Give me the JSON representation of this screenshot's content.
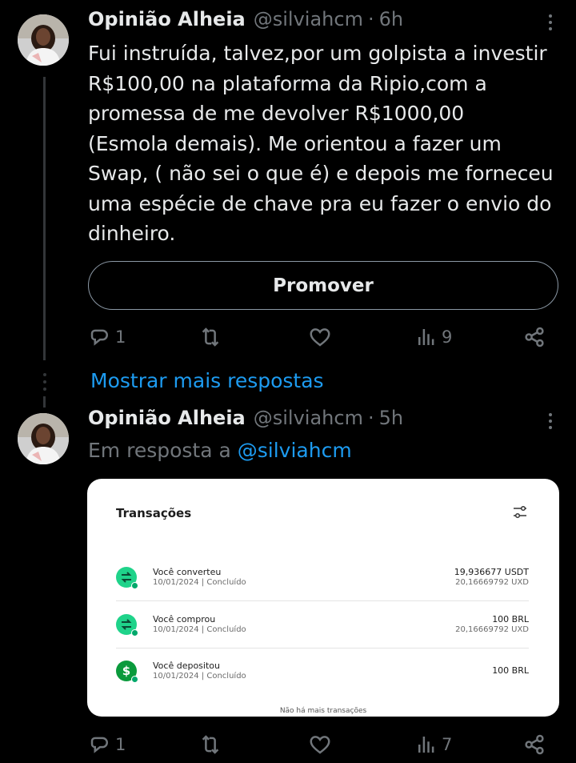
{
  "tweets": [
    {
      "name": "Opinião Alheia",
      "handle": "@silviahcm",
      "separator": "·",
      "time": "6h",
      "text": "Fui instruída, talvez,por um golpista a investir\nR$100,00 na plataforma da Ripio,com a\npromessa de me devolver R$1000,00\n(Esmola demais). Me orientou a fazer um\nSwap, ( não sei o que é) e depois me forneceu\numa espécie de chave pra eu fazer o envio do\ndinheiro.",
      "promote_label": "Promover",
      "replies": "1",
      "views": "9"
    },
    {
      "name": "Opinião Alheia",
      "handle": "@silviahcm",
      "separator": "·",
      "time": "5h",
      "reply_prefix": "Em resposta a",
      "reply_mention": "@silviahcm",
      "replies": "1",
      "views": "7"
    }
  ],
  "show_more_label": "Mostrar mais respostas",
  "media": {
    "title": "Transações",
    "transactions": [
      {
        "title": "Você converteu",
        "date": "10/01/2024 | Concluído",
        "amount_main": "19,936677 USDT",
        "amount_sub": "20,16669792 UXD",
        "icon": "swap-icon"
      },
      {
        "title": "Você comprou",
        "date": "10/01/2024 | Concluído",
        "amount_main": "100 BRL",
        "amount_sub": "20,16669792 UXD",
        "icon": "swap-icon"
      },
      {
        "title": "Você depositou",
        "date": "10/01/2024 | Concluído",
        "amount_main": "100 BRL",
        "amount_sub": "",
        "icon": "dollar-icon"
      }
    ],
    "footer": "Não há mais transações"
  },
  "colors": {
    "background": "#000000",
    "text": "#e7e9ea",
    "muted": "#71767b",
    "link": "#1d9bf0",
    "tx_icon_green": "#1fd38a",
    "tx_icon_dark": "#0a9a3c"
  }
}
